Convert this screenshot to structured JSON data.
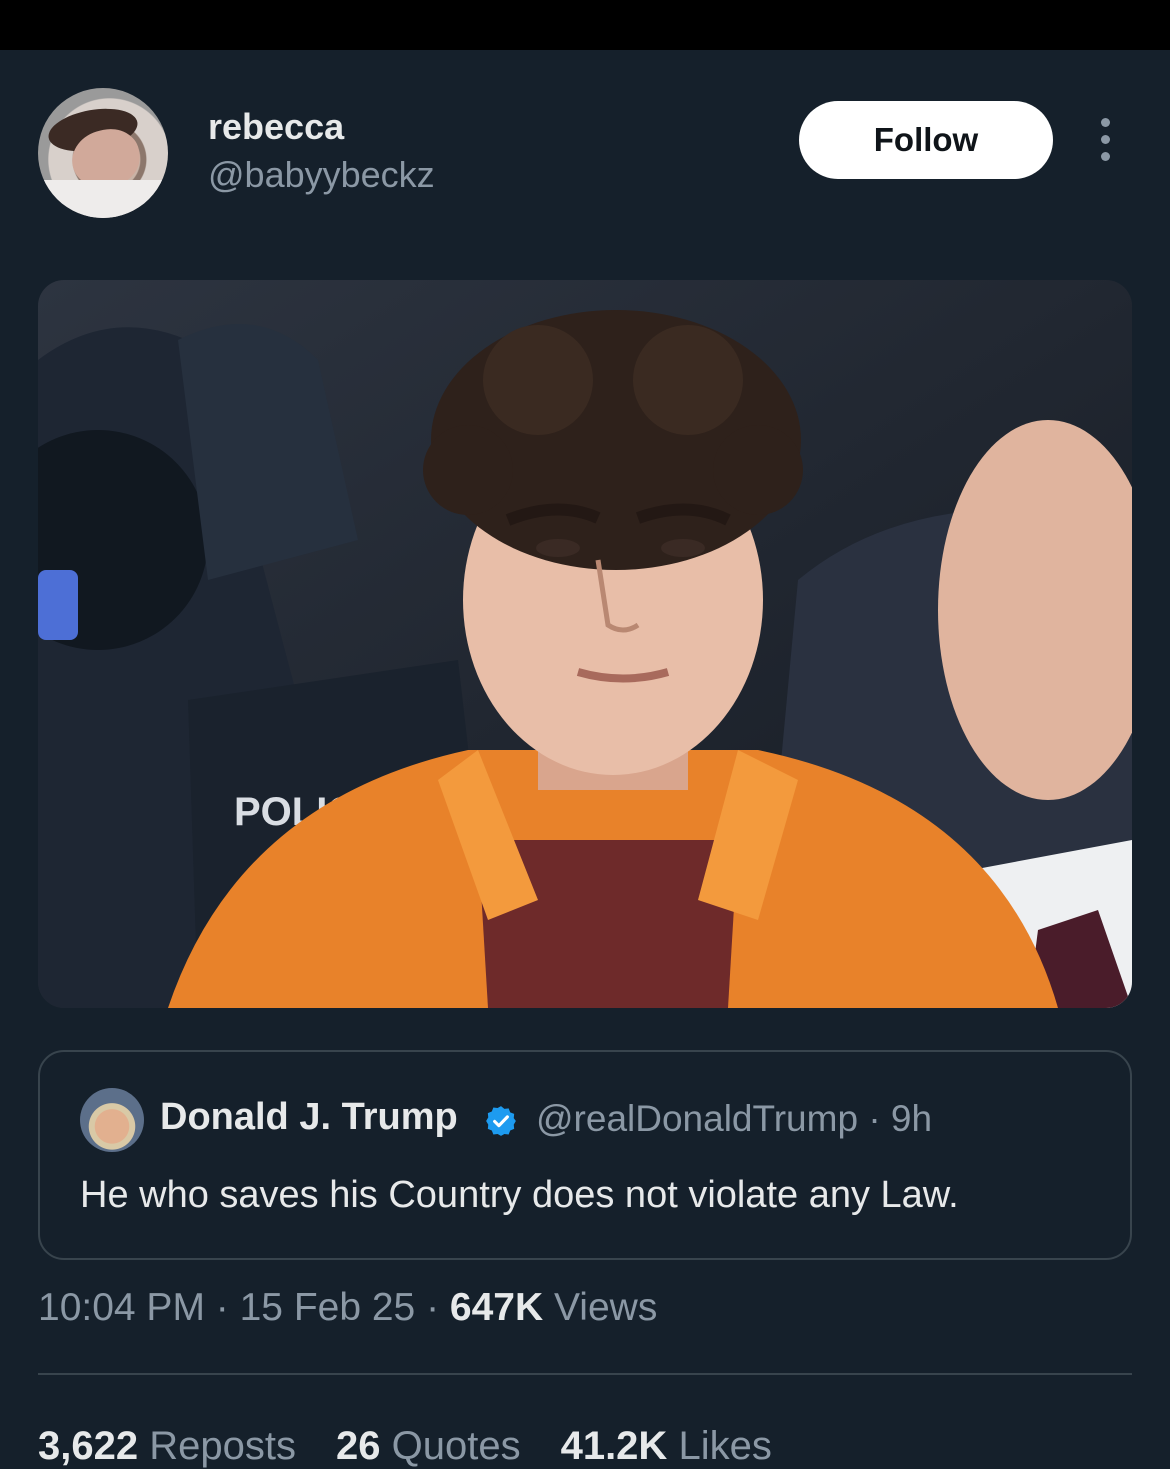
{
  "author": {
    "display_name": "rebecca",
    "handle": "@babyybeckz",
    "follow_label": "Follow"
  },
  "media": {
    "jacket_text": "POLIC"
  },
  "quoted_post": {
    "display_name": "Donald J. Trump",
    "handle_time": "@realDonaldTrump · 9h",
    "text": "He who saves his Country does not violate any Law."
  },
  "meta": {
    "time": "10:04 PM",
    "date": "15 Feb 25",
    "separator": " · ",
    "views_count": "647K",
    "views_label": "Views"
  },
  "stats": {
    "reposts_count": "3,622",
    "reposts_label": "Reposts",
    "quotes_count": "26",
    "quotes_label": "Quotes",
    "likes_count": "41.2K",
    "likes_label": "Likes"
  },
  "colors": {
    "background": "#15202b",
    "secondary_text": "#8b98a5",
    "verified": "#1d9bf0",
    "jumpsuit": "#e8822a"
  }
}
